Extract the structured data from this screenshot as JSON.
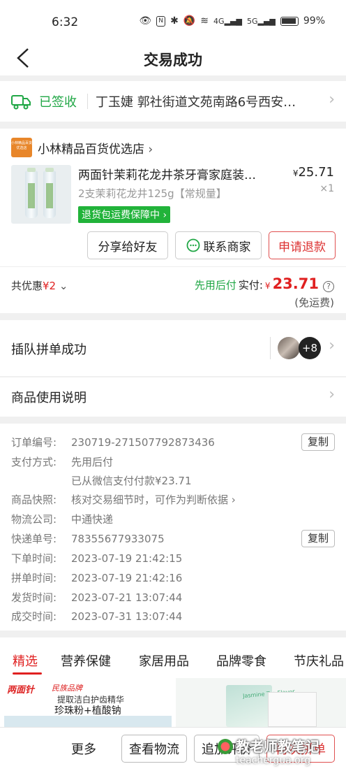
{
  "status_bar": {
    "time": "6:32",
    "battery": "99%",
    "net1": "4G",
    "net2": "5G"
  },
  "nav": {
    "title": "交易成功"
  },
  "delivery": {
    "status": "已签收",
    "address": "丁玉婕 郭社街道文苑南路6号西安…"
  },
  "order": {
    "shop_logo_text": "小林精品百货优选店",
    "shop_name": "小林精品百货优选店",
    "product_title": "两面针茉莉花龙井茶牙膏家庭装…",
    "price_symbol": "¥",
    "price": "25.71",
    "spec": "2支茉莉花龙井125g【常规量】",
    "quantity": "×1",
    "badge": "退货包运费保障中",
    "buttons": {
      "share": "分享给好友",
      "contact": "联系商家",
      "refund": "申请退款"
    },
    "discount_label": "共优惠",
    "discount_amount": "¥2",
    "pay_later": "先用后付",
    "paid_label": "实付:",
    "paid_symbol": "¥",
    "paid_amount": "23.71",
    "free_shipping": "(免运费)"
  },
  "team": {
    "label": "插队拼单成功",
    "more_count": "+8"
  },
  "usage": {
    "label": "商品使用说明"
  },
  "info": {
    "rows": [
      {
        "key": "订单编号:",
        "value": "230719-271507792873436"
      },
      {
        "key": "支付方式:",
        "value": "先用后付"
      },
      {
        "key": "",
        "value": "已从微信支付付款¥23.71"
      },
      {
        "key": "商品快照:",
        "value": "核对交易细节时，可作为判断依据"
      },
      {
        "key": "物流公司:",
        "value": "中通快递"
      },
      {
        "key": "快递单号:",
        "value": "78355677933075"
      },
      {
        "key": "下单时间:",
        "value": "2023-07-19 21:42:15"
      },
      {
        "key": "拼单时间:",
        "value": "2023-07-19 21:42:16"
      },
      {
        "key": "发货时间:",
        "value": "2023-07-21 13:07:44"
      },
      {
        "key": "成交时间:",
        "value": "2023-07-31 13:07:44"
      }
    ],
    "copy_label": "复制"
  },
  "tabs": [
    "精选",
    "营养保健",
    "家居用品",
    "品牌零食",
    "节庆礼品"
  ],
  "promo": {
    "brand": "两面针",
    "brand_sub": "民族品牌",
    "line1": "提取洁白护齿精华",
    "line2": "珍珠粉+植酸钠",
    "package_text": "Jasmine Tea Flavor"
  },
  "bottom_bar": {
    "more": "更多",
    "logistics": "查看物流",
    "review": "追加评价",
    "rebuy": "再次拼单"
  },
  "watermark": {
    "main": "教老师教笔记",
    "sub": "teachergua.org"
  },
  "colors": {
    "accent_red": "#e02020",
    "green": "#21a746",
    "badge_green": "#21b33a",
    "shop_logo": "#e8862a"
  }
}
